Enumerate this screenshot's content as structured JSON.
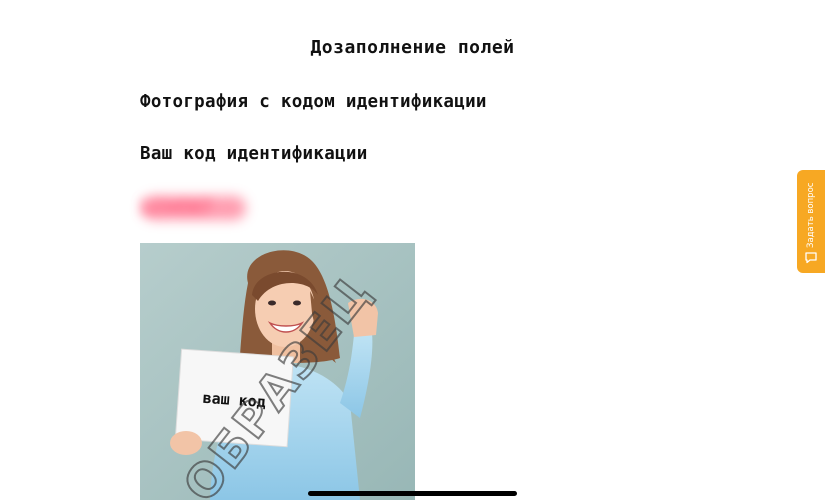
{
  "header": {
    "title": "Дозаполнение полей"
  },
  "main": {
    "photo_heading": "Фотография с кодом идентификации",
    "code_heading": "Ваш код идентификации",
    "code_value": "1234567",
    "sample_photo": {
      "sign_text": "ваш код",
      "watermark": "ОБРАЗЕЦ"
    }
  },
  "ask_question": {
    "label": "Задать вопрос",
    "icon": "chat-bubble-icon",
    "color": "#f7a823"
  }
}
